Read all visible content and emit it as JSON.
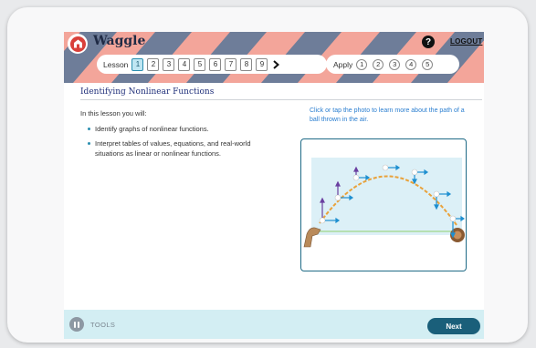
{
  "header": {
    "brand": "Waggle",
    "help_label": "?",
    "logout_label": "LOGOUT",
    "lesson_label": "Lesson",
    "lessons": [
      "1",
      "2",
      "3",
      "4",
      "5",
      "6",
      "7",
      "8",
      "9"
    ],
    "active_lesson": "1",
    "next_lessons_label": "›",
    "apply_label": "Apply",
    "apply_items": [
      "1",
      "2",
      "3",
      "4",
      "5"
    ]
  },
  "content": {
    "title": "Identifying Nonlinear Functions",
    "intro": "In this lesson you will:",
    "bullets": [
      "Identify graphs of nonlinear functions.",
      "Interpret tables of values, equations, and real-world situations as linear or nonlinear functions."
    ],
    "photo_caption": "Click or tap the photo to learn more about the path of a ball thrown in the air."
  },
  "footer": {
    "tools_label": "TOOLS",
    "next_label": "Next"
  },
  "colors": {
    "header_bg": "#6e7d99",
    "stripe": "#f3a59a",
    "title": "#1f2f7a",
    "caption": "#2a7ed0",
    "footer_bg": "#d3eef3",
    "next_button": "#1a5f7a",
    "arc": "#e9a23b",
    "vector_blue": "#1e8fd0",
    "vector_purple": "#6a3fa0"
  },
  "icons": {
    "logo": "barn-logo-icon",
    "help": "question-circle-icon",
    "chevron": "chevron-right-icon",
    "tools": "pause-tools-icon"
  }
}
